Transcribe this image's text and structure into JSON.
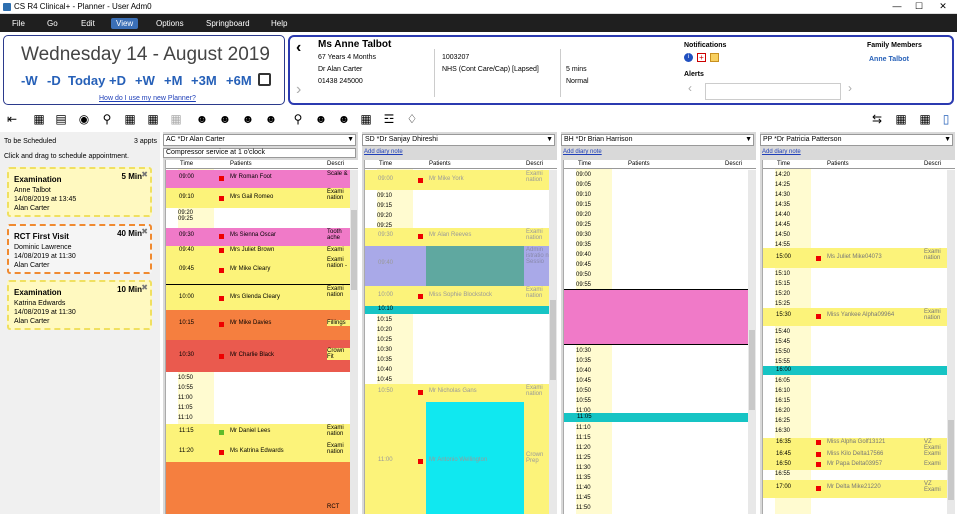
{
  "window": {
    "title": "CS R4 Clinical+ - Planner - User Adm0",
    "min": "—",
    "max": "☐",
    "close": "✕"
  },
  "menu": [
    {
      "label": "File"
    },
    {
      "label": "Go"
    },
    {
      "label": "Edit"
    },
    {
      "label": "View"
    },
    {
      "label": "Options"
    },
    {
      "label": "Springboard"
    },
    {
      "label": "Help"
    }
  ],
  "date": {
    "text": "Wednesday 14 - August 2019",
    "nav": [
      "-W",
      "-D",
      "Today",
      "+D",
      "+W",
      "+M",
      "+3M",
      "+6M"
    ],
    "help": "How do I use my new Planner?"
  },
  "patient": {
    "name": "Ms Anne Talbot",
    "age": "67 Years 4 Months",
    "doctor": "Dr Alan Carter",
    "phone": "01438 245000",
    "id": "1003207",
    "nhs": "NHS (Cont Care/Cap) [Lapsed]",
    "mins": "5 mins",
    "status": "Normal",
    "notifications": "Notifications",
    "alerts": "Alerts",
    "family_label": "Family Members",
    "family": "Anne Talbot"
  },
  "left": {
    "header": "To be Scheduled",
    "count": "3 appts",
    "hint": "Click and drag to schedule appointment.",
    "cards": [
      {
        "title": "Examination",
        "dur": "5 Min",
        "patient": "Anne Talbot",
        "when": "14/08/2019 at 13:45",
        "clinician": "Alan Carter"
      },
      {
        "title": "RCT First Visit",
        "dur": "40 Min",
        "patient": "Dominic Lawrence",
        "when": "14/08/2019 at 11:30",
        "clinician": "Alan Carter"
      },
      {
        "title": "Examination",
        "dur": "10 Min",
        "patient": "Katrina Edwards",
        "when": "14/08/2019 at 11:30",
        "clinician": "Alan Carter"
      }
    ]
  },
  "grid_headers": {
    "time": "Time",
    "patients": "Patients",
    "desc": "Descri"
  },
  "columns": [
    {
      "combo": "AC *Dr Alan Carter",
      "note": "Compressor service at 1 o'clock"
    },
    {
      "combo": "SD *Dr Sanjay Dhireshi",
      "note": "Add diary note"
    },
    {
      "combo": "BH *Dr Brian Harrison",
      "note": "Add diary note"
    },
    {
      "combo": "PP *Dr Patricia Patterson",
      "note": "Add diary note"
    }
  ],
  "colors": {
    "menubar": "#1f1f1f",
    "accent": "#2660b8",
    "pink": "#f07ac8",
    "yellow": "#fcf37a",
    "cyan": "#16c4c4"
  }
}
